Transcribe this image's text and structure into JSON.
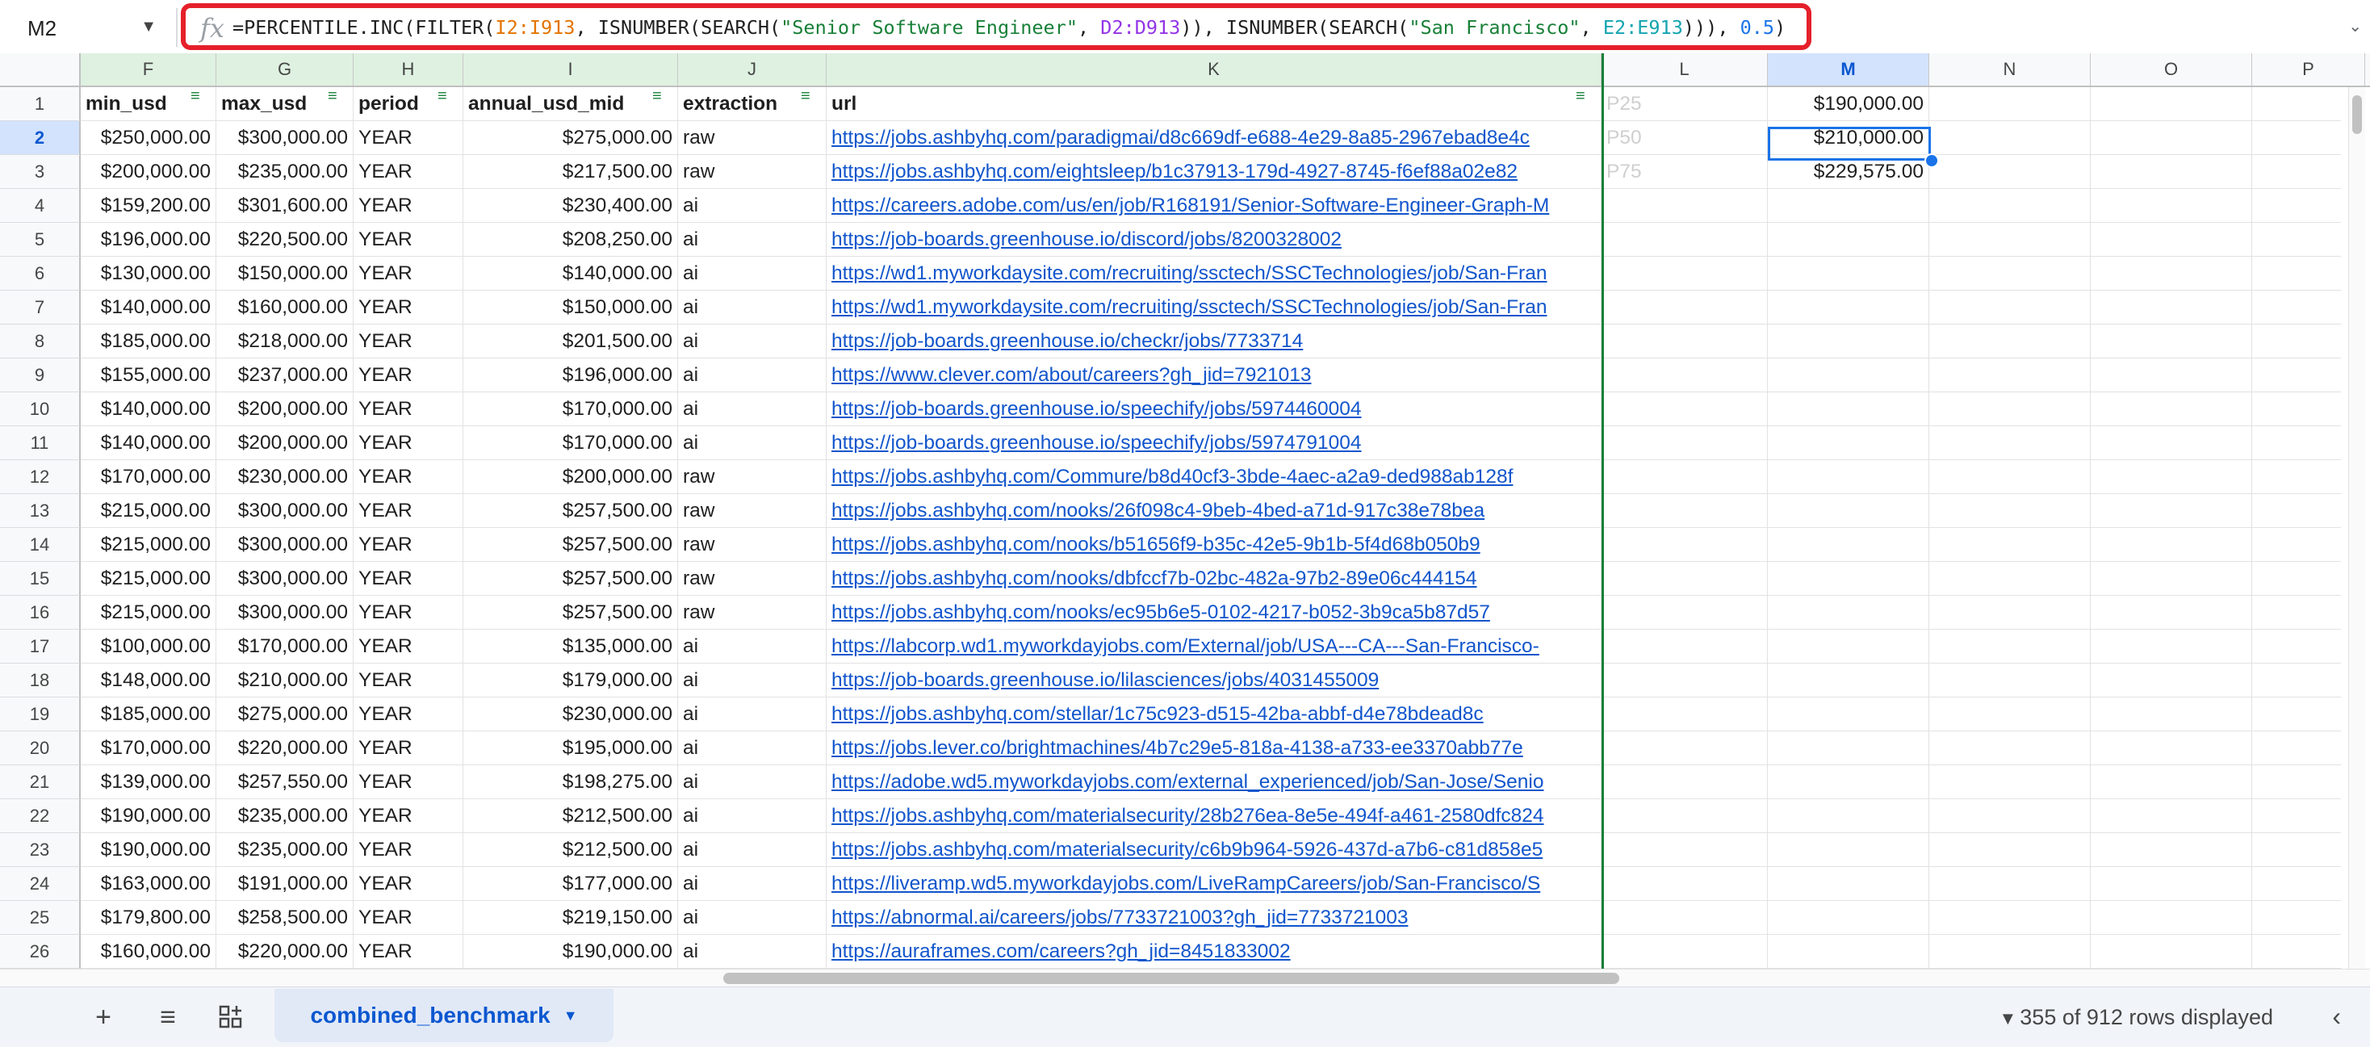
{
  "formula_bar": {
    "name_box": "M2",
    "fx_icon": "fx-icon",
    "formula_parts": [
      {
        "text": "=PERCENTILE.INC(FILTER(",
        "color": "default"
      },
      {
        "text": "I2:I913",
        "color": "orange"
      },
      {
        "text": ", ISNUMBER(SEARCH(",
        "color": "default"
      },
      {
        "text": "\"Senior Software Engineer\"",
        "color": "green"
      },
      {
        "text": ", ",
        "color": "default"
      },
      {
        "text": "D2:D913",
        "color": "purple"
      },
      {
        "text": ")), ISNUMBER(SEARCH(",
        "color": "default"
      },
      {
        "text": "\"San Francisco\"",
        "color": "green"
      },
      {
        "text": ", ",
        "color": "default"
      },
      {
        "text": "E2:E913",
        "color": "teal"
      },
      {
        "text": "))), ",
        "color": "default"
      },
      {
        "text": "0.5",
        "color": "blue"
      },
      {
        "text": ")",
        "color": "default"
      }
    ],
    "highlight_color": "#e5202a"
  },
  "columns": [
    "F",
    "G",
    "H",
    "I",
    "J",
    "K",
    "L",
    "M",
    "N",
    "O",
    "P"
  ],
  "selected_column": "M",
  "selected_cell": "M2",
  "header_row": {
    "F": "min_usd",
    "G": "max_usd",
    "H": "period",
    "I": "annual_usd_mid",
    "J": "extraction",
    "K": "url"
  },
  "side_labels": [
    "P25",
    "P50",
    "P75"
  ],
  "side_values": [
    "$190,000.00",
    "$210,000.00",
    "$229,575.00"
  ],
  "rows": [
    {
      "n": "2",
      "F": "$250,000.00",
      "G": "$300,000.00",
      "H": "YEAR",
      "I": "$275,000.00",
      "J": "raw",
      "K": "https://jobs.ashbyhq.com/paradigmai/d8c669df-e688-4e29-8a85-2967ebad8e4c"
    },
    {
      "n": "3",
      "F": "$200,000.00",
      "G": "$235,000.00",
      "H": "YEAR",
      "I": "$217,500.00",
      "J": "raw",
      "K": "https://jobs.ashbyhq.com/eightsleep/b1c37913-179d-4927-8745-f6ef88a02e82"
    },
    {
      "n": "4",
      "F": "$159,200.00",
      "G": "$301,600.00",
      "H": "YEAR",
      "I": "$230,400.00",
      "J": "ai",
      "K": "https://careers.adobe.com/us/en/job/R168191/Senior-Software-Engineer-Graph-M"
    },
    {
      "n": "5",
      "F": "$196,000.00",
      "G": "$220,500.00",
      "H": "YEAR",
      "I": "$208,250.00",
      "J": "ai",
      "K": "https://job-boards.greenhouse.io/discord/jobs/8200328002"
    },
    {
      "n": "6",
      "F": "$130,000.00",
      "G": "$150,000.00",
      "H": "YEAR",
      "I": "$140,000.00",
      "J": "ai",
      "K": "https://wd1.myworkdaysite.com/recruiting/ssctech/SSCTechnologies/job/San-Fran"
    },
    {
      "n": "7",
      "F": "$140,000.00",
      "G": "$160,000.00",
      "H": "YEAR",
      "I": "$150,000.00",
      "J": "ai",
      "K": "https://wd1.myworkdaysite.com/recruiting/ssctech/SSCTechnologies/job/San-Fran"
    },
    {
      "n": "8",
      "F": "$185,000.00",
      "G": "$218,000.00",
      "H": "YEAR",
      "I": "$201,500.00",
      "J": "ai",
      "K": "https://job-boards.greenhouse.io/checkr/jobs/7733714"
    },
    {
      "n": "9",
      "F": "$155,000.00",
      "G": "$237,000.00",
      "H": "YEAR",
      "I": "$196,000.00",
      "J": "ai",
      "K": "https://www.clever.com/about/careers?gh_jid=7921013"
    },
    {
      "n": "10",
      "F": "$140,000.00",
      "G": "$200,000.00",
      "H": "YEAR",
      "I": "$170,000.00",
      "J": "ai",
      "K": "https://job-boards.greenhouse.io/speechify/jobs/5974460004"
    },
    {
      "n": "11",
      "F": "$140,000.00",
      "G": "$200,000.00",
      "H": "YEAR",
      "I": "$170,000.00",
      "J": "ai",
      "K": "https://job-boards.greenhouse.io/speechify/jobs/5974791004"
    },
    {
      "n": "12",
      "F": "$170,000.00",
      "G": "$230,000.00",
      "H": "YEAR",
      "I": "$200,000.00",
      "J": "raw",
      "K": "https://jobs.ashbyhq.com/Commure/b8d40cf3-3bde-4aec-a2a9-ded988ab128f"
    },
    {
      "n": "13",
      "F": "$215,000.00",
      "G": "$300,000.00",
      "H": "YEAR",
      "I": "$257,500.00",
      "J": "raw",
      "K": "https://jobs.ashbyhq.com/nooks/26f098c4-9beb-4bed-a71d-917c38e78bea"
    },
    {
      "n": "14",
      "F": "$215,000.00",
      "G": "$300,000.00",
      "H": "YEAR",
      "I": "$257,500.00",
      "J": "raw",
      "K": "https://jobs.ashbyhq.com/nooks/b51656f9-b35c-42e5-9b1b-5f4d68b050b9"
    },
    {
      "n": "15",
      "F": "$215,000.00",
      "G": "$300,000.00",
      "H": "YEAR",
      "I": "$257,500.00",
      "J": "raw",
      "K": "https://jobs.ashbyhq.com/nooks/dbfccf7b-02bc-482a-97b2-89e06c444154"
    },
    {
      "n": "16",
      "F": "$215,000.00",
      "G": "$300,000.00",
      "H": "YEAR",
      "I": "$257,500.00",
      "J": "raw",
      "K": "https://jobs.ashbyhq.com/nooks/ec95b6e5-0102-4217-b052-3b9ca5b87d57"
    },
    {
      "n": "17",
      "F": "$100,000.00",
      "G": "$170,000.00",
      "H": "YEAR",
      "I": "$135,000.00",
      "J": "ai",
      "K": "https://labcorp.wd1.myworkdayjobs.com/External/job/USA---CA---San-Francisco-"
    },
    {
      "n": "18",
      "F": "$148,000.00",
      "G": "$210,000.00",
      "H": "YEAR",
      "I": "$179,000.00",
      "J": "ai",
      "K": "https://job-boards.greenhouse.io/lilasciences/jobs/4031455009"
    },
    {
      "n": "19",
      "F": "$185,000.00",
      "G": "$275,000.00",
      "H": "YEAR",
      "I": "$230,000.00",
      "J": "ai",
      "K": "https://jobs.ashbyhq.com/stellar/1c75c923-d515-42ba-abbf-d4e78bdead8c"
    },
    {
      "n": "20",
      "F": "$170,000.00",
      "G": "$220,000.00",
      "H": "YEAR",
      "I": "$195,000.00",
      "J": "ai",
      "K": "https://jobs.lever.co/brightmachines/4b7c29e5-818a-4138-a733-ee3370abb77e"
    },
    {
      "n": "21",
      "F": "$139,000.00",
      "G": "$257,550.00",
      "H": "YEAR",
      "I": "$198,275.00",
      "J": "ai",
      "K": "https://adobe.wd5.myworkdayjobs.com/external_experienced/job/San-Jose/Senio"
    },
    {
      "n": "22",
      "F": "$190,000.00",
      "G": "$235,000.00",
      "H": "YEAR",
      "I": "$212,500.00",
      "J": "ai",
      "K": "https://jobs.ashbyhq.com/materialsecurity/28b276ea-8e5e-494f-a461-2580dfc824"
    },
    {
      "n": "23",
      "F": "$190,000.00",
      "G": "$235,000.00",
      "H": "YEAR",
      "I": "$212,500.00",
      "J": "ai",
      "K": "https://jobs.ashbyhq.com/materialsecurity/c6b9b964-5926-437d-a7b6-c81d858e5"
    },
    {
      "n": "24",
      "F": "$163,000.00",
      "G": "$191,000.00",
      "H": "YEAR",
      "I": "$177,000.00",
      "J": "ai",
      "K": "https://liveramp.wd5.myworkdayjobs.com/LiveRampCareers/job/San-Francisco/S"
    },
    {
      "n": "25",
      "F": "$179,800.00",
      "G": "$258,500.00",
      "H": "YEAR",
      "I": "$219,150.00",
      "J": "ai",
      "K": "https://abnormal.ai/careers/jobs/7733721003?gh_jid=7733721003"
    },
    {
      "n": "26",
      "F": "$160,000.00",
      "G": "$220,000.00",
      "H": "YEAR",
      "I": "$190,000.00",
      "J": "ai",
      "K": "https://auraframes.com/careers?gh_jid=8451833002"
    }
  ],
  "bottom_bar": {
    "add_sheet_icon": "plus-icon",
    "all_sheets_icon": "menu-icon",
    "sheet_tab_label": "combined_benchmark",
    "status": "355 of 912 rows displayed",
    "collapse_icon": "chevron-left-icon"
  }
}
